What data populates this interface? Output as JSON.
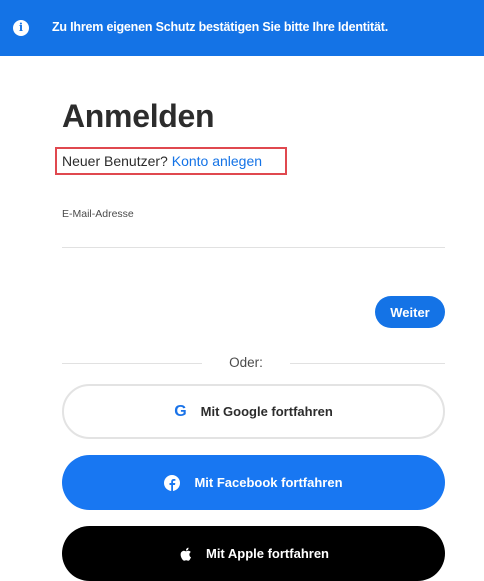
{
  "banner": {
    "text": "Zu Ihrem eigenen Schutz bestätigen Sie bitte Ihre Identität.",
    "icon": "info-icon"
  },
  "signin": {
    "title": "Anmelden",
    "new_user_text": "Neuer Benutzer?",
    "create_account_link": "Konto anlegen",
    "email_label": "E-Mail-Adresse",
    "email_value": "",
    "next_button": "Weiter"
  },
  "divider": {
    "text": "Oder:"
  },
  "social": {
    "google_label": "Mit Google fortfahren",
    "facebook_label": "Mit Facebook fortfahren",
    "apple_label": "Mit Apple fortfahren"
  },
  "colors": {
    "accent": "#1473e6",
    "facebook": "#1877f2",
    "apple": "#000000",
    "highlight_border": "#e0484f"
  }
}
